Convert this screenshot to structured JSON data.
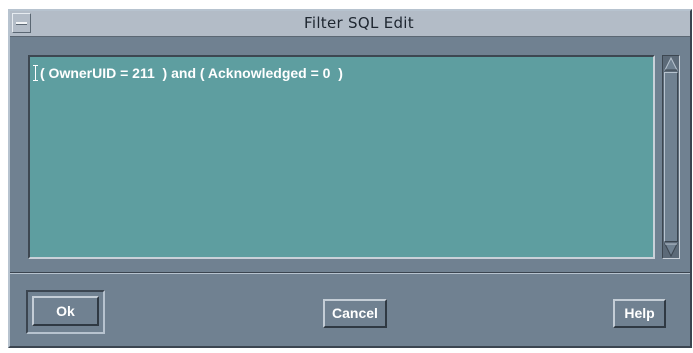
{
  "window": {
    "title": "Filter SQL Edit"
  },
  "editor": {
    "sql": "( OwnerUID = 211  ) and ( Acknowledged = 0  )"
  },
  "buttons": {
    "ok_label": "Ok",
    "cancel_label": "Cancel",
    "help_label": "Help"
  },
  "icons": {
    "window_menu": "window-menu-icon",
    "scroll_up": "scroll-up-arrow-icon",
    "scroll_down": "scroll-down-arrow-icon",
    "text_cursor": "text-cursor-icon"
  },
  "colors": {
    "window_bg": "#708191",
    "titlebar_bg": "#b3bcc7",
    "editor_bg": "#5e9ea0",
    "text": "#ffffff"
  }
}
